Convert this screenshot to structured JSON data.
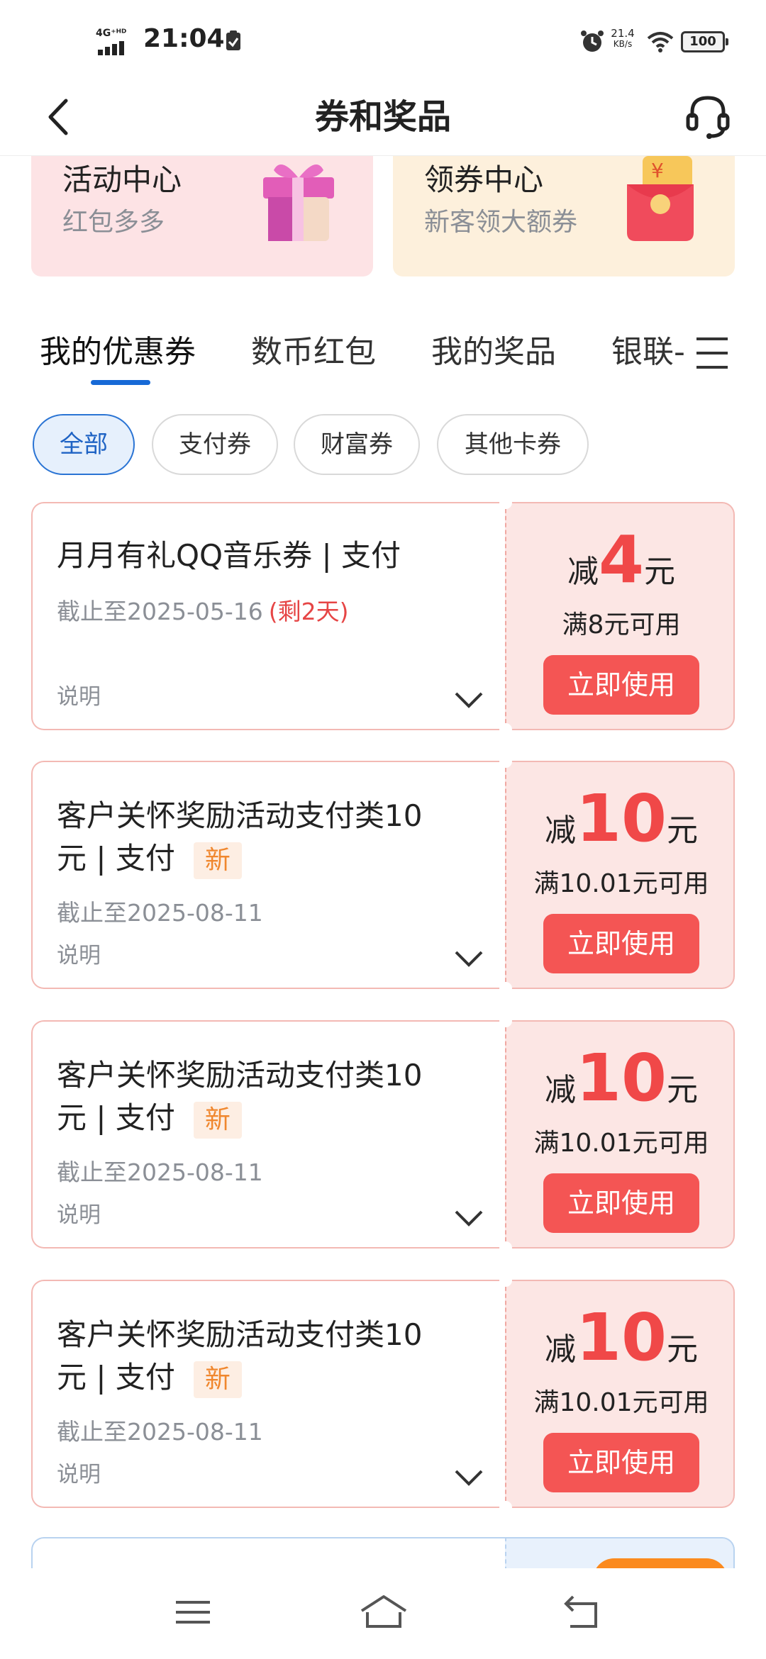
{
  "status_bar": {
    "network": "4G⁺ᴴᴰ",
    "time": "21:04",
    "speed_value": "21.4",
    "speed_unit": "KB/s",
    "battery": "100"
  },
  "header": {
    "title": "券和奖品"
  },
  "promo_cards": [
    {
      "title": "活动中心",
      "subtitle": "红包多多",
      "icon": "gift-box-icon"
    },
    {
      "title": "领券中心",
      "subtitle": "新客领大额券",
      "icon": "red-envelope-icon"
    }
  ],
  "tabs": [
    {
      "label": "我的优惠券",
      "active": true
    },
    {
      "label": "数币红包",
      "active": false
    },
    {
      "label": "我的奖品",
      "active": false
    },
    {
      "label": "银联-",
      "active": false
    }
  ],
  "filters": [
    {
      "label": "全部",
      "active": true
    },
    {
      "label": "支付券",
      "active": false
    },
    {
      "label": "财富券",
      "active": false
    },
    {
      "label": "其他卡券",
      "active": false
    }
  ],
  "coupons": [
    {
      "title": "月月有礼QQ音乐券 | 支付",
      "title_line2": "",
      "badge": "",
      "expire": "截止至2025-05-16",
      "remaining": "(剩2天)",
      "description": "说明",
      "prefix": "减",
      "amount": "4",
      "suffix": "元",
      "condition": "满8元可用",
      "button": "立即使用"
    },
    {
      "title": "客户关怀奖励活动支付类10",
      "title_line2": "元 | 支付",
      "badge": "新",
      "expire": "截止至2025-08-11",
      "remaining": "",
      "description": "说明",
      "prefix": "减",
      "amount": "10",
      "suffix": "元",
      "condition": "满10.01元可用",
      "button": "立即使用"
    },
    {
      "title": "客户关怀奖励活动支付类10",
      "title_line2": "元 | 支付",
      "badge": "新",
      "expire": "截止至2025-08-11",
      "remaining": "",
      "description": "说明",
      "prefix": "减",
      "amount": "10",
      "suffix": "元",
      "condition": "满10.01元可用",
      "button": "立即使用"
    },
    {
      "title": "客户关怀奖励活动支付类10",
      "title_line2": "元 | 支付",
      "badge": "新",
      "expire": "截止至2025-08-11",
      "remaining": "",
      "description": "说明",
      "prefix": "减",
      "amount": "10",
      "suffix": "元",
      "condition": "满10.01元可用",
      "button": "立即使用"
    }
  ],
  "colors": {
    "accent_blue": "#1769d6",
    "coupon_red": "#f04848",
    "button_red": "#f45554",
    "new_badge_orange": "#f0872e"
  }
}
